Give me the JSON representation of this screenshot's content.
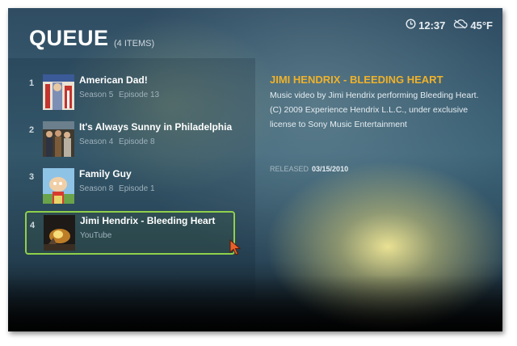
{
  "header": {
    "title": "QUEUE",
    "count": "(4 ITEMS)",
    "time": "12:37",
    "temperature": "45°F"
  },
  "queue": [
    {
      "num": "1",
      "name": "American Dad!",
      "season": "Season 5",
      "episode": "Episode 13"
    },
    {
      "num": "2",
      "name": "It's Always Sunny in Philadelphia",
      "season": "Season 4",
      "episode": "Episode 8"
    },
    {
      "num": "3",
      "name": "Family Guy",
      "season": "Season 8",
      "episode": "Episode 1"
    },
    {
      "num": "4",
      "name": "Jimi Hendrix - Bleeding Heart",
      "source": "YouTube"
    }
  ],
  "detail": {
    "title": "JIMI HENDRIX - BLEEDING HEART",
    "description": "Music video by Jimi Hendrix performing Bleeding Heart. (C) 2009 Experience Hendrix L.L.C., under exclusive license to Sony Music Entertainment",
    "released_label": "RELEASED",
    "released_date": "03/15/2010"
  },
  "colors": {
    "accent": "#f0b22a",
    "selection": "#8fd04a"
  },
  "icons": {
    "clock": "clock-icon",
    "weather": "cloudy-weather-icon"
  }
}
